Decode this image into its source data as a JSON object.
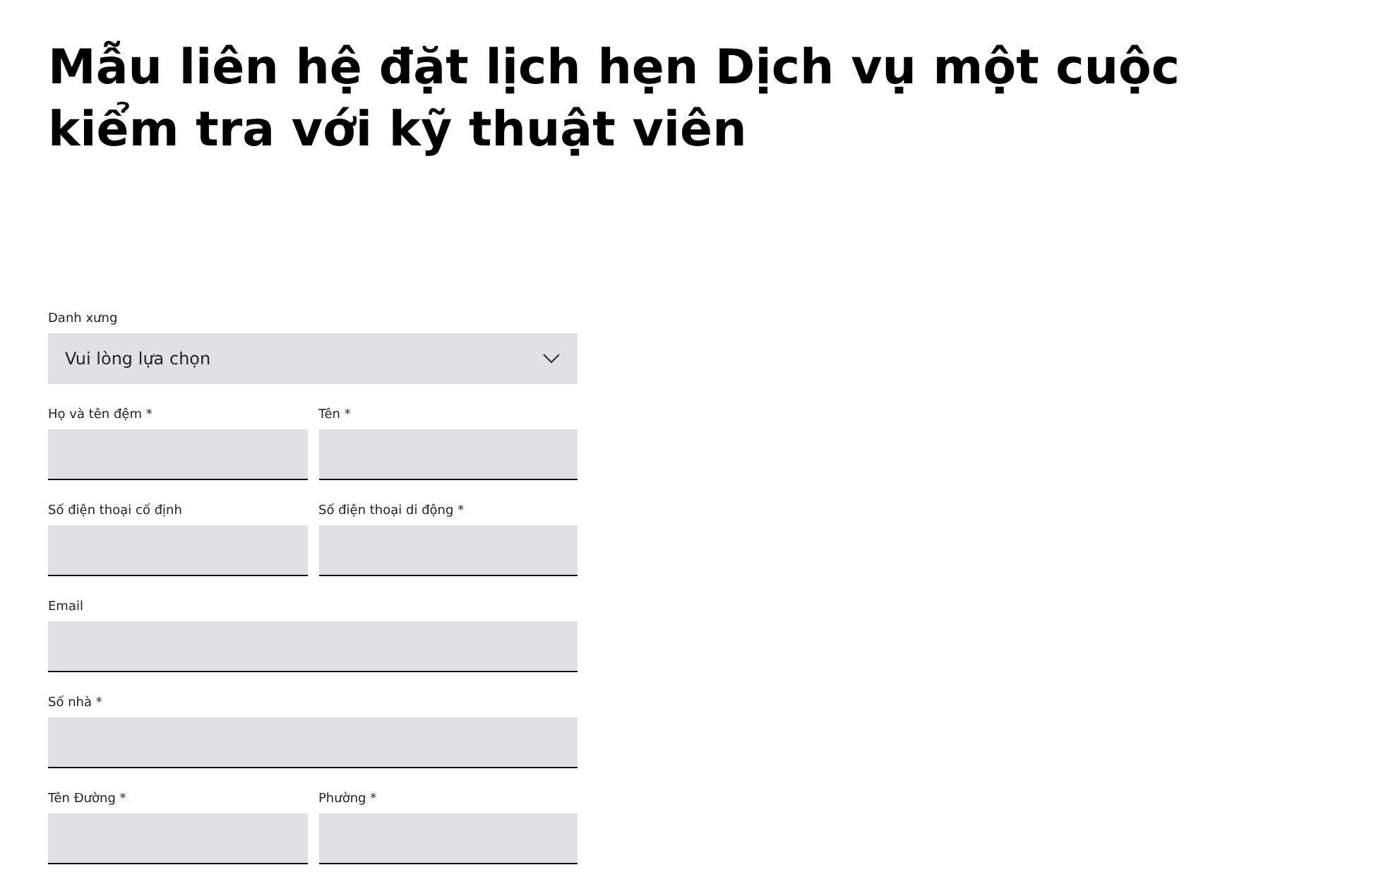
{
  "title": "Mẫu liên hệ đặt lịch hẹn Dịch vụ một cuộc kiểm tra với kỹ thuật viên",
  "form_rows": [
    {
      "fields": [
        {
          "kind": "select",
          "label": "Danh xưng",
          "value": "Vui lòng lựa chọn"
        }
      ]
    },
    {
      "fields": [
        {
          "kind": "text",
          "label": "Họ và tên đệm *"
        },
        {
          "kind": "text",
          "label": "Tên *"
        }
      ]
    },
    {
      "fields": [
        {
          "kind": "text",
          "label": "Số điện thoại cố định"
        },
        {
          "kind": "text",
          "label": "Số điện thoại di động *"
        }
      ]
    },
    {
      "fields": [
        {
          "kind": "text",
          "label": "Email"
        }
      ]
    },
    {
      "fields": [
        {
          "kind": "text",
          "label": "Số nhà *"
        }
      ]
    },
    {
      "fields": [
        {
          "kind": "text",
          "label": "Tên Đường *"
        },
        {
          "kind": "text",
          "label": "Phường *"
        }
      ]
    }
  ]
}
